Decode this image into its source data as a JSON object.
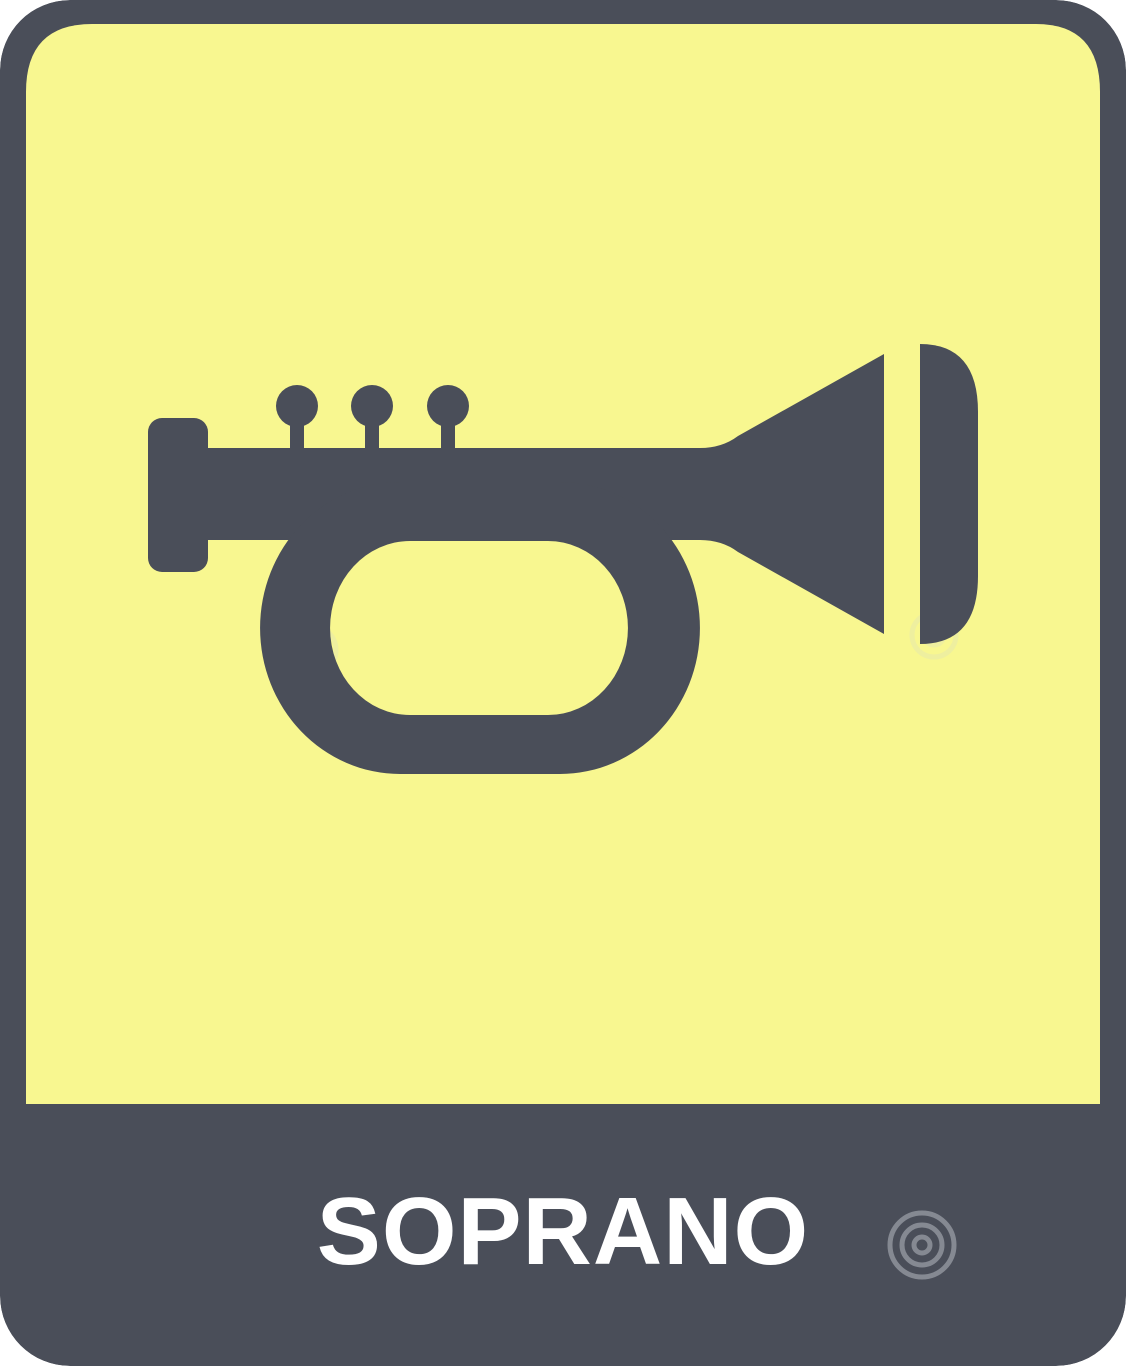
{
  "card": {
    "label": "SOPRANO",
    "icon": "trumpet-icon"
  },
  "colors": {
    "frame": "#4a4e59",
    "panel": "#f8f790",
    "text": "#ffffff",
    "watermark": "#cfd3da"
  },
  "watermark": {
    "text": "dreamstime"
  }
}
